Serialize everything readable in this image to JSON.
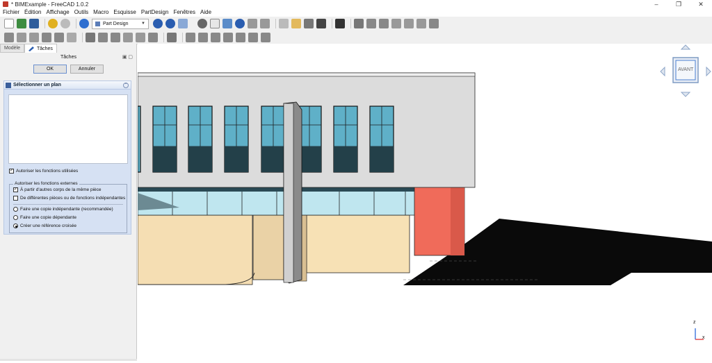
{
  "window": {
    "title": "* BIMExample - FreeCAD 1.0.2",
    "buttons": [
      "–",
      "❐",
      "✕"
    ]
  },
  "menu": [
    "Fichier",
    "Édition",
    "Affichage",
    "Outils",
    "Macro",
    "Esquisse",
    "PartDesign",
    "Fenêtres",
    "Aide"
  ],
  "workbench": {
    "selected": "Part Design"
  },
  "panel": {
    "tabs": [
      "Modèle",
      "Tâches"
    ],
    "header": "Tâches",
    "ok_label": "OK",
    "cancel_label": "Annuler",
    "task_title": "Sélectionner un plan",
    "allow_used_label": "Autoriser les fonctions utilisées",
    "allow_used_checked": true,
    "external_group_label": "Autoriser les fonctions externes",
    "same_part_label": "À partir d'autres corps de la même pièce",
    "same_part_checked": true,
    "other_parts_label": "De différentes pièces ou de fonctions indépendantes",
    "other_parts_checked": false,
    "copy_independent_label": "Faire une copie indépendante (recommandée)",
    "copy_dependent_label": "Faire une copie dépendante",
    "cross_reference_label": "Créer une référence croisée",
    "selected_option": "cross_reference"
  },
  "navcube": {
    "face_label": "AVANT"
  },
  "axis": {
    "z_label": "z",
    "x_label": "x"
  },
  "icons": [
    "new-icon",
    "open-icon",
    "save-icon",
    "undo-icon",
    "redo-icon",
    "refresh-icon",
    "zoom-icon",
    "view-icon",
    "sketch-icon",
    "pad-icon",
    "pocket-icon"
  ]
}
